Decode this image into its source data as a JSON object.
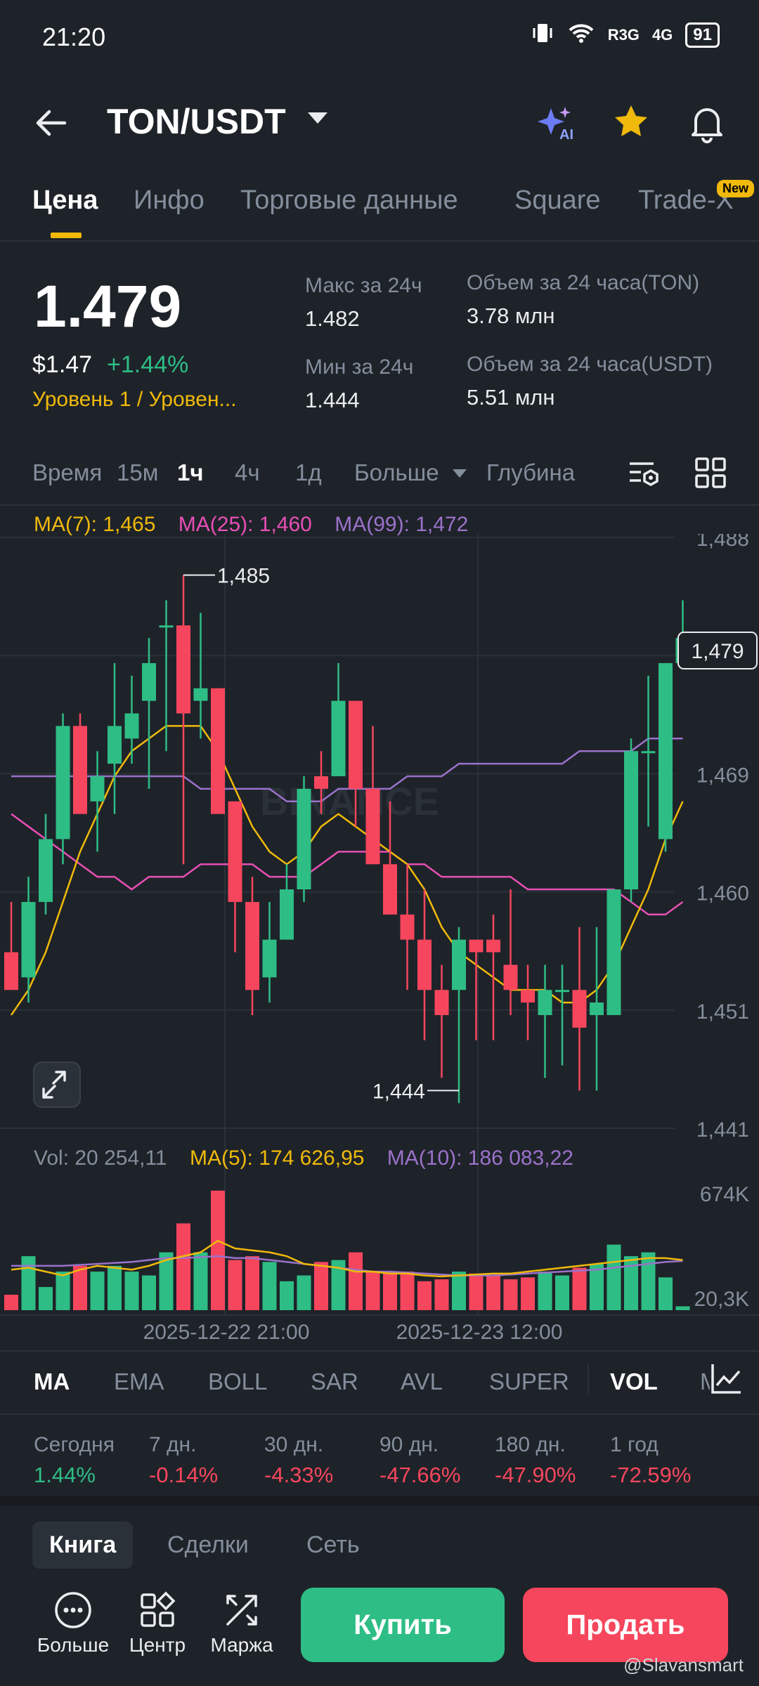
{
  "status": {
    "time": "21:20",
    "network1": "R3G",
    "network2": "4G",
    "battery": "91"
  },
  "header": {
    "pair": "TON/USDT",
    "ai_label": "AI"
  },
  "tabs": [
    {
      "label": "Цена"
    },
    {
      "label": "Инфо"
    },
    {
      "label": "Торговые данные"
    },
    {
      "label": "Square"
    },
    {
      "label": "Trade-X"
    }
  ],
  "new_badge": "New",
  "price": {
    "last": "1.479",
    "usd": "$1.47",
    "change": "+1.44%",
    "level": "Уровень 1 / Уровен..."
  },
  "stats": {
    "high_label": "Макс за 24ч",
    "high": "1.482",
    "low_label": "Мин за 24ч",
    "low": "1.444",
    "vol_base_label": "Объем за 24 часа(TON)",
    "vol_base": "3.78 млн",
    "vol_quote_label": "Объем за 24 часа(USDT)",
    "vol_quote": "5.51 млн"
  },
  "intervals": {
    "time": "Время",
    "i15m": "15м",
    "i1h": "1ч",
    "i4h": "4ч",
    "i1d": "1д",
    "more": "Больше",
    "depth": "Глубина"
  },
  "ma_legend": {
    "ma7": "MA(7): 1,465",
    "ma25": "MA(25): 1,460",
    "ma99": "MA(99): 1,472"
  },
  "vol_legend": {
    "vol": "Vol: 20 254,11",
    "ma5": "MA(5): 174 626,95",
    "ma10": "MA(10): 186 083,22"
  },
  "chart_data": {
    "type": "candlestick",
    "price_axis": [
      "1,488",
      "1,479",
      "1,469",
      "1,460",
      "1,451",
      "1,441"
    ],
    "current_price_tag": "1,479",
    "high_marker": "1,485",
    "low_marker": "1,444",
    "watermark": "BINANCE",
    "volume_axis": [
      "674K",
      "20,3K"
    ],
    "time_labels": [
      "2025-12-22 21:00",
      "2025-12-23 12:00"
    ],
    "ylim": [
      1.441,
      1.488
    ],
    "candles": [
      {
        "o": 1.455,
        "h": 1.459,
        "l": 1.452,
        "c": 1.452
      },
      {
        "o": 1.453,
        "h": 1.461,
        "l": 1.451,
        "c": 1.459
      },
      {
        "o": 1.459,
        "h": 1.466,
        "l": 1.458,
        "c": 1.464
      },
      {
        "o": 1.464,
        "h": 1.474,
        "l": 1.462,
        "c": 1.473
      },
      {
        "o": 1.473,
        "h": 1.474,
        "l": 1.466,
        "c": 1.466
      },
      {
        "o": 1.467,
        "h": 1.471,
        "l": 1.463,
        "c": 1.469
      },
      {
        "o": 1.47,
        "h": 1.478,
        "l": 1.466,
        "c": 1.473
      },
      {
        "o": 1.472,
        "h": 1.477,
        "l": 1.47,
        "c": 1.474
      },
      {
        "o": 1.475,
        "h": 1.48,
        "l": 1.468,
        "c": 1.478
      },
      {
        "o": 1.481,
        "h": 1.483,
        "l": 1.471,
        "c": 1.481
      },
      {
        "o": 1.481,
        "h": 1.485,
        "l": 1.462,
        "c": 1.474
      },
      {
        "o": 1.475,
        "h": 1.482,
        "l": 1.472,
        "c": 1.476
      },
      {
        "o": 1.476,
        "h": 1.476,
        "l": 1.466,
        "c": 1.466
      },
      {
        "o": 1.467,
        "h": 1.467,
        "l": 1.455,
        "c": 1.459
      },
      {
        "o": 1.459,
        "h": 1.461,
        "l": 1.45,
        "c": 1.452
      },
      {
        "o": 1.453,
        "h": 1.459,
        "l": 1.451,
        "c": 1.456
      },
      {
        "o": 1.456,
        "h": 1.462,
        "l": 1.456,
        "c": 1.46
      },
      {
        "o": 1.46,
        "h": 1.469,
        "l": 1.459,
        "c": 1.468
      },
      {
        "o": 1.469,
        "h": 1.471,
        "l": 1.466,
        "c": 1.468
      },
      {
        "o": 1.469,
        "h": 1.478,
        "l": 1.469,
        "c": 1.475
      },
      {
        "o": 1.475,
        "h": 1.474,
        "l": 1.465,
        "c": 1.468
      },
      {
        "o": 1.468,
        "h": 1.473,
        "l": 1.462,
        "c": 1.462
      },
      {
        "o": 1.462,
        "h": 1.467,
        "l": 1.458,
        "c": 1.458
      },
      {
        "o": 1.458,
        "h": 1.462,
        "l": 1.452,
        "c": 1.456
      },
      {
        "o": 1.456,
        "h": 1.46,
        "l": 1.448,
        "c": 1.452
      },
      {
        "o": 1.452,
        "h": 1.454,
        "l": 1.445,
        "c": 1.45
      },
      {
        "o": 1.452,
        "h": 1.457,
        "l": 1.443,
        "c": 1.456
      },
      {
        "o": 1.456,
        "h": 1.456,
        "l": 1.448,
        "c": 1.455
      },
      {
        "o": 1.456,
        "h": 1.458,
        "l": 1.448,
        "c": 1.455
      },
      {
        "o": 1.454,
        "h": 1.46,
        "l": 1.45,
        "c": 1.452
      },
      {
        "o": 1.452,
        "h": 1.454,
        "l": 1.448,
        "c": 1.451
      },
      {
        "o": 1.45,
        "h": 1.454,
        "l": 1.445,
        "c": 1.452
      },
      {
        "o": 1.452,
        "h": 1.454,
        "l": 1.446,
        "c": 1.452
      },
      {
        "o": 1.452,
        "h": 1.457,
        "l": 1.444,
        "c": 1.449
      },
      {
        "o": 1.45,
        "h": 1.457,
        "l": 1.444,
        "c": 1.451
      },
      {
        "o": 1.45,
        "h": 1.46,
        "l": 1.45,
        "c": 1.46
      },
      {
        "o": 1.46,
        "h": 1.472,
        "l": 1.459,
        "c": 1.471
      },
      {
        "o": 1.471,
        "h": 1.477,
        "l": 1.465,
        "c": 1.471
      },
      {
        "o": 1.464,
        "h": 1.478,
        "l": 1.463,
        "c": 1.478
      },
      {
        "o": 1.478,
        "h": 1.483,
        "l": 1.478,
        "c": 1.48
      }
    ],
    "ma7": [
      1.45,
      1.452,
      1.455,
      1.459,
      1.463,
      1.466,
      1.469,
      1.471,
      1.472,
      1.473,
      1.473,
      1.473,
      1.471,
      1.468,
      1.465,
      1.463,
      1.462,
      1.463,
      1.465,
      1.466,
      1.465,
      1.464,
      1.463,
      1.462,
      1.46,
      1.457,
      1.455,
      1.454,
      1.453,
      1.452,
      1.452,
      1.452,
      1.451,
      1.451,
      1.452,
      1.454,
      1.457,
      1.46,
      1.464,
      1.467
    ],
    "ma25": [
      1.466,
      1.465,
      1.464,
      1.463,
      1.462,
      1.461,
      1.461,
      1.46,
      1.461,
      1.461,
      1.461,
      1.462,
      1.462,
      1.462,
      1.462,
      1.461,
      1.461,
      1.461,
      1.462,
      1.463,
      1.463,
      1.463,
      1.463,
      1.462,
      1.462,
      1.461,
      1.461,
      1.461,
      1.461,
      1.461,
      1.46,
      1.46,
      1.46,
      1.46,
      1.46,
      1.46,
      1.459,
      1.458,
      1.458,
      1.459
    ],
    "ma99": [
      1.469,
      1.469,
      1.469,
      1.469,
      1.469,
      1.469,
      1.469,
      1.469,
      1.469,
      1.469,
      1.469,
      1.468,
      1.468,
      1.468,
      1.468,
      1.468,
      1.467,
      1.467,
      1.467,
      1.468,
      1.468,
      1.468,
      1.468,
      1.469,
      1.469,
      1.469,
      1.47,
      1.47,
      1.47,
      1.47,
      1.47,
      1.47,
      1.47,
      1.471,
      1.471,
      1.471,
      1.471,
      1.472,
      1.472,
      1.472
    ],
    "volumes": [
      80,
      280,
      120,
      200,
      230,
      200,
      230,
      200,
      180,
      300,
      450,
      300,
      620,
      260,
      280,
      250,
      150,
      180,
      250,
      260,
      300,
      200,
      200,
      200,
      150,
      160,
      200,
      190,
      180,
      160,
      170,
      200,
      180,
      220,
      240,
      340,
      280,
      300,
      170,
      20
    ],
    "vol_ma5": [
      210,
      220,
      200,
      180,
      210,
      230,
      220,
      210,
      230,
      260,
      280,
      300,
      360,
      320,
      310,
      300,
      280,
      240,
      230,
      220,
      200,
      200,
      190,
      190,
      180,
      175,
      180,
      185,
      190,
      190,
      200,
      210,
      220,
      230,
      240,
      250,
      260,
      270,
      270,
      260
    ],
    "vol_ma10": [
      230,
      230,
      230,
      230,
      235,
      240,
      245,
      250,
      260,
      270,
      270,
      275,
      280,
      270,
      270,
      260,
      250,
      240,
      230,
      220,
      210,
      200,
      200,
      195,
      190,
      185,
      180,
      180,
      180,
      185,
      190,
      195,
      200,
      205,
      210,
      220,
      230,
      240,
      250,
      255
    ]
  },
  "indicators": [
    "MA",
    "EMA",
    "BOLL",
    "SAR",
    "AVL",
    "SUPER",
    "VOL",
    "MACD"
  ],
  "performance": [
    {
      "label": "Сегодня",
      "value": "1.44%",
      "status": "up"
    },
    {
      "label": "7 дн.",
      "value": "-0.14%",
      "status": "down"
    },
    {
      "label": "30 дн.",
      "value": "-4.33%",
      "status": "down"
    },
    {
      "label": "90 дн.",
      "value": "-47.66%",
      "status": "down"
    },
    {
      "label": "180 дн.",
      "value": "-47.90%",
      "status": "down"
    },
    {
      "label": "1 год",
      "value": "-72.59%",
      "status": "down"
    }
  ],
  "book_tabs": [
    "Книга",
    "Сделки",
    "Сеть"
  ],
  "bottom": {
    "more": "Больше",
    "center": "Центр",
    "margin": "Маржа",
    "buy": "Купить",
    "sell": "Продать"
  },
  "watermark_text": "@Slavansmart",
  "colors": {
    "up": "#2ebd85",
    "down": "#f6465d",
    "ma7": "#f0b90b",
    "ma25": "#e84fb6",
    "ma99": "#9b72cb",
    "accent": "#f0b90b"
  }
}
